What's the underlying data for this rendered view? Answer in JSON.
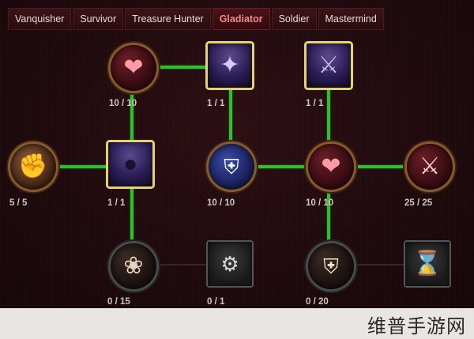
{
  "tabs": [
    {
      "label": "Vanquisher",
      "active": false
    },
    {
      "label": "Survivor",
      "active": false
    },
    {
      "label": "Treasure Hunter",
      "active": false
    },
    {
      "label": "Gladiator",
      "active": true
    },
    {
      "label": "Soldier",
      "active": false
    },
    {
      "label": "Mastermind",
      "active": false
    }
  ],
  "nodes": {
    "heart_top": {
      "rank": "10 / 10",
      "icon": "heart-icon"
    },
    "shadow_boot": {
      "rank": "1 / 1",
      "icon": "winged-boot-icon"
    },
    "warrior": {
      "rank": "1 / 1",
      "icon": "warrior-figure-icon"
    },
    "fist": {
      "rank": "5 / 5",
      "icon": "fist-icon"
    },
    "dark_figure": {
      "rank": "1 / 1",
      "icon": "dark-figure-icon"
    },
    "blue_shield": {
      "rank": "10 / 10",
      "icon": "shield-icon"
    },
    "heart_mid": {
      "rank": "10 / 10",
      "icon": "heart-icon"
    },
    "crossed_swords": {
      "rank": "25 / 25",
      "icon": "crossed-swords-icon"
    },
    "vortex": {
      "rank": "0 / 15",
      "icon": "vortex-icon"
    },
    "trap": {
      "rank": "0 / 1",
      "icon": "bear-trap-icon"
    },
    "shield_bottom": {
      "rank": "0 / 20",
      "icon": "shield-icon"
    },
    "hourglass": {
      "rank": "",
      "icon": "hourglass-icon"
    }
  },
  "watermark": "维普手游网"
}
